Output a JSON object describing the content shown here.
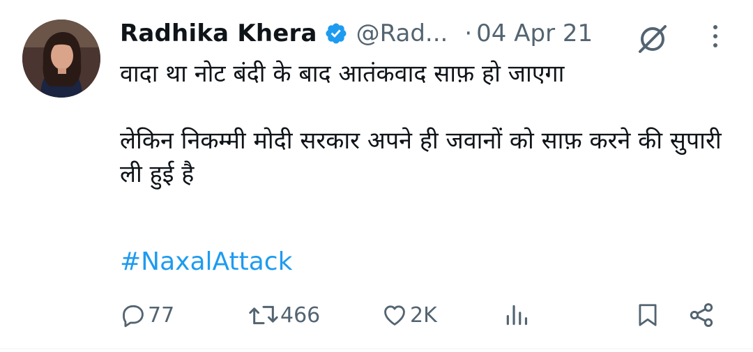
{
  "tweet": {
    "author_name": "Radhika Khera",
    "handle": "@Rad...",
    "separator": "·",
    "date": "04 Apr 21",
    "verified": true,
    "text": "वादा था नोट बंदी के बाद आतंकवाद साफ़ हो जाएगा\n\nलेकिन निकम्मी मोदी सरकार अपने ही जवानों को साफ़ करने की सुपारी ली हुई है",
    "hashtag": "#NaxalAttack"
  },
  "actions": {
    "replies": "77",
    "retweets": "466",
    "likes": "2K"
  },
  "colors": {
    "accent": "#1d9bf0",
    "secondary_text": "#536471",
    "primary_text": "#0f1419"
  },
  "icons": [
    "verified-badge-icon",
    "grok-icon",
    "more-icon",
    "reply-icon",
    "retweet-icon",
    "like-icon",
    "views-icon",
    "bookmark-icon",
    "share-icon"
  ]
}
